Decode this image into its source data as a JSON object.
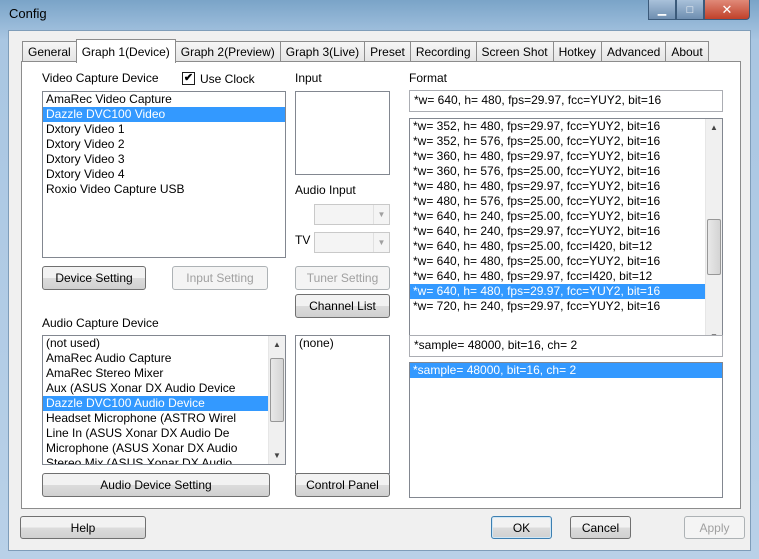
{
  "window": {
    "title": "Config"
  },
  "caption": {
    "min_icon": "▁",
    "max_icon": "□",
    "close_icon": "✕"
  },
  "tabs": [
    "General",
    "Graph 1(Device)",
    "Graph 2(Preview)",
    "Graph 3(Live)",
    "Preset",
    "Recording",
    "Screen Shot",
    "Hotkey",
    "Advanced",
    "About"
  ],
  "active_tab": "Graph 1(Device)",
  "video": {
    "label": "Video Capture Device",
    "use_clock_label": "Use Clock",
    "use_clock_checked": true,
    "check_mark": "✔",
    "devices": [
      "AmaRec Video Capture",
      "Dazzle DVC100 Video",
      "Dxtory Video 1",
      "Dxtory Video 2",
      "Dxtory Video 3",
      "Dxtory Video 4",
      "Roxio Video Capture USB"
    ],
    "selected": "Dazzle DVC100 Video",
    "device_setting_btn": "Device Setting",
    "input_setting_btn": "Input Setting"
  },
  "input": {
    "label": "Input",
    "audio_input_label": "Audio Input",
    "tv_label": "TV",
    "tuner_setting_btn": "Tuner Setting",
    "channel_list_btn": "Channel List"
  },
  "format": {
    "label": "Format",
    "current": "*w= 640, h= 480, fps=29.97,  fcc=YUY2, bit=16",
    "items": [
      "*w= 352, h= 480, fps=29.97,  fcc=YUY2, bit=16",
      "*w= 352, h= 576, fps=25.00,  fcc=YUY2, bit=16",
      "*w= 360, h= 480, fps=29.97,  fcc=YUY2, bit=16",
      "*w= 360, h= 576, fps=25.00,  fcc=YUY2, bit=16",
      "*w= 480, h= 480, fps=29.97,  fcc=YUY2, bit=16",
      "*w= 480, h= 576, fps=25.00,  fcc=YUY2, bit=16",
      "*w= 640, h= 240, fps=25.00,  fcc=YUY2, bit=16",
      "*w= 640, h= 240, fps=29.97,  fcc=YUY2, bit=16",
      "*w= 640, h= 480, fps=25.00,  fcc=I420, bit=12",
      "*w= 640, h= 480, fps=25.00,  fcc=YUY2, bit=16",
      "*w= 640, h= 480, fps=29.97,  fcc=I420, bit=12",
      "*w= 640, h= 480, fps=29.97,  fcc=YUY2, bit=16",
      "*w= 720, h= 240, fps=29.97,  fcc=YUY2, bit=16"
    ],
    "selected_index": 11
  },
  "audio": {
    "label": "Audio Capture Device",
    "devices": [
      "(not used)",
      "AmaRec Audio Capture",
      "AmaRec Stereo Mixer",
      "Aux (ASUS Xonar DX Audio Device",
      "Dazzle DVC100 Audio Device",
      "Headset Microphone (ASTRO Wirel",
      "Line In (ASUS Xonar DX Audio De",
      "Microphone (ASUS Xonar DX Audio",
      "Stereo Mix (ASUS Xonar DX Audio"
    ],
    "selected": "Dazzle DVC100 Audio Device",
    "setting_btn": "Audio Device Setting",
    "control_list": [
      "(none)"
    ],
    "control_panel_btn": "Control Panel",
    "format_current": "*sample= 48000, bit=16, ch= 2",
    "format_items": [
      "*sample= 48000, bit=16, ch= 2"
    ],
    "format_selected_index": 0
  },
  "footer": {
    "help": "Help",
    "ok": "OK",
    "cancel": "Cancel",
    "apply": "Apply"
  },
  "icons": {
    "up": "▲",
    "down": "▼"
  }
}
